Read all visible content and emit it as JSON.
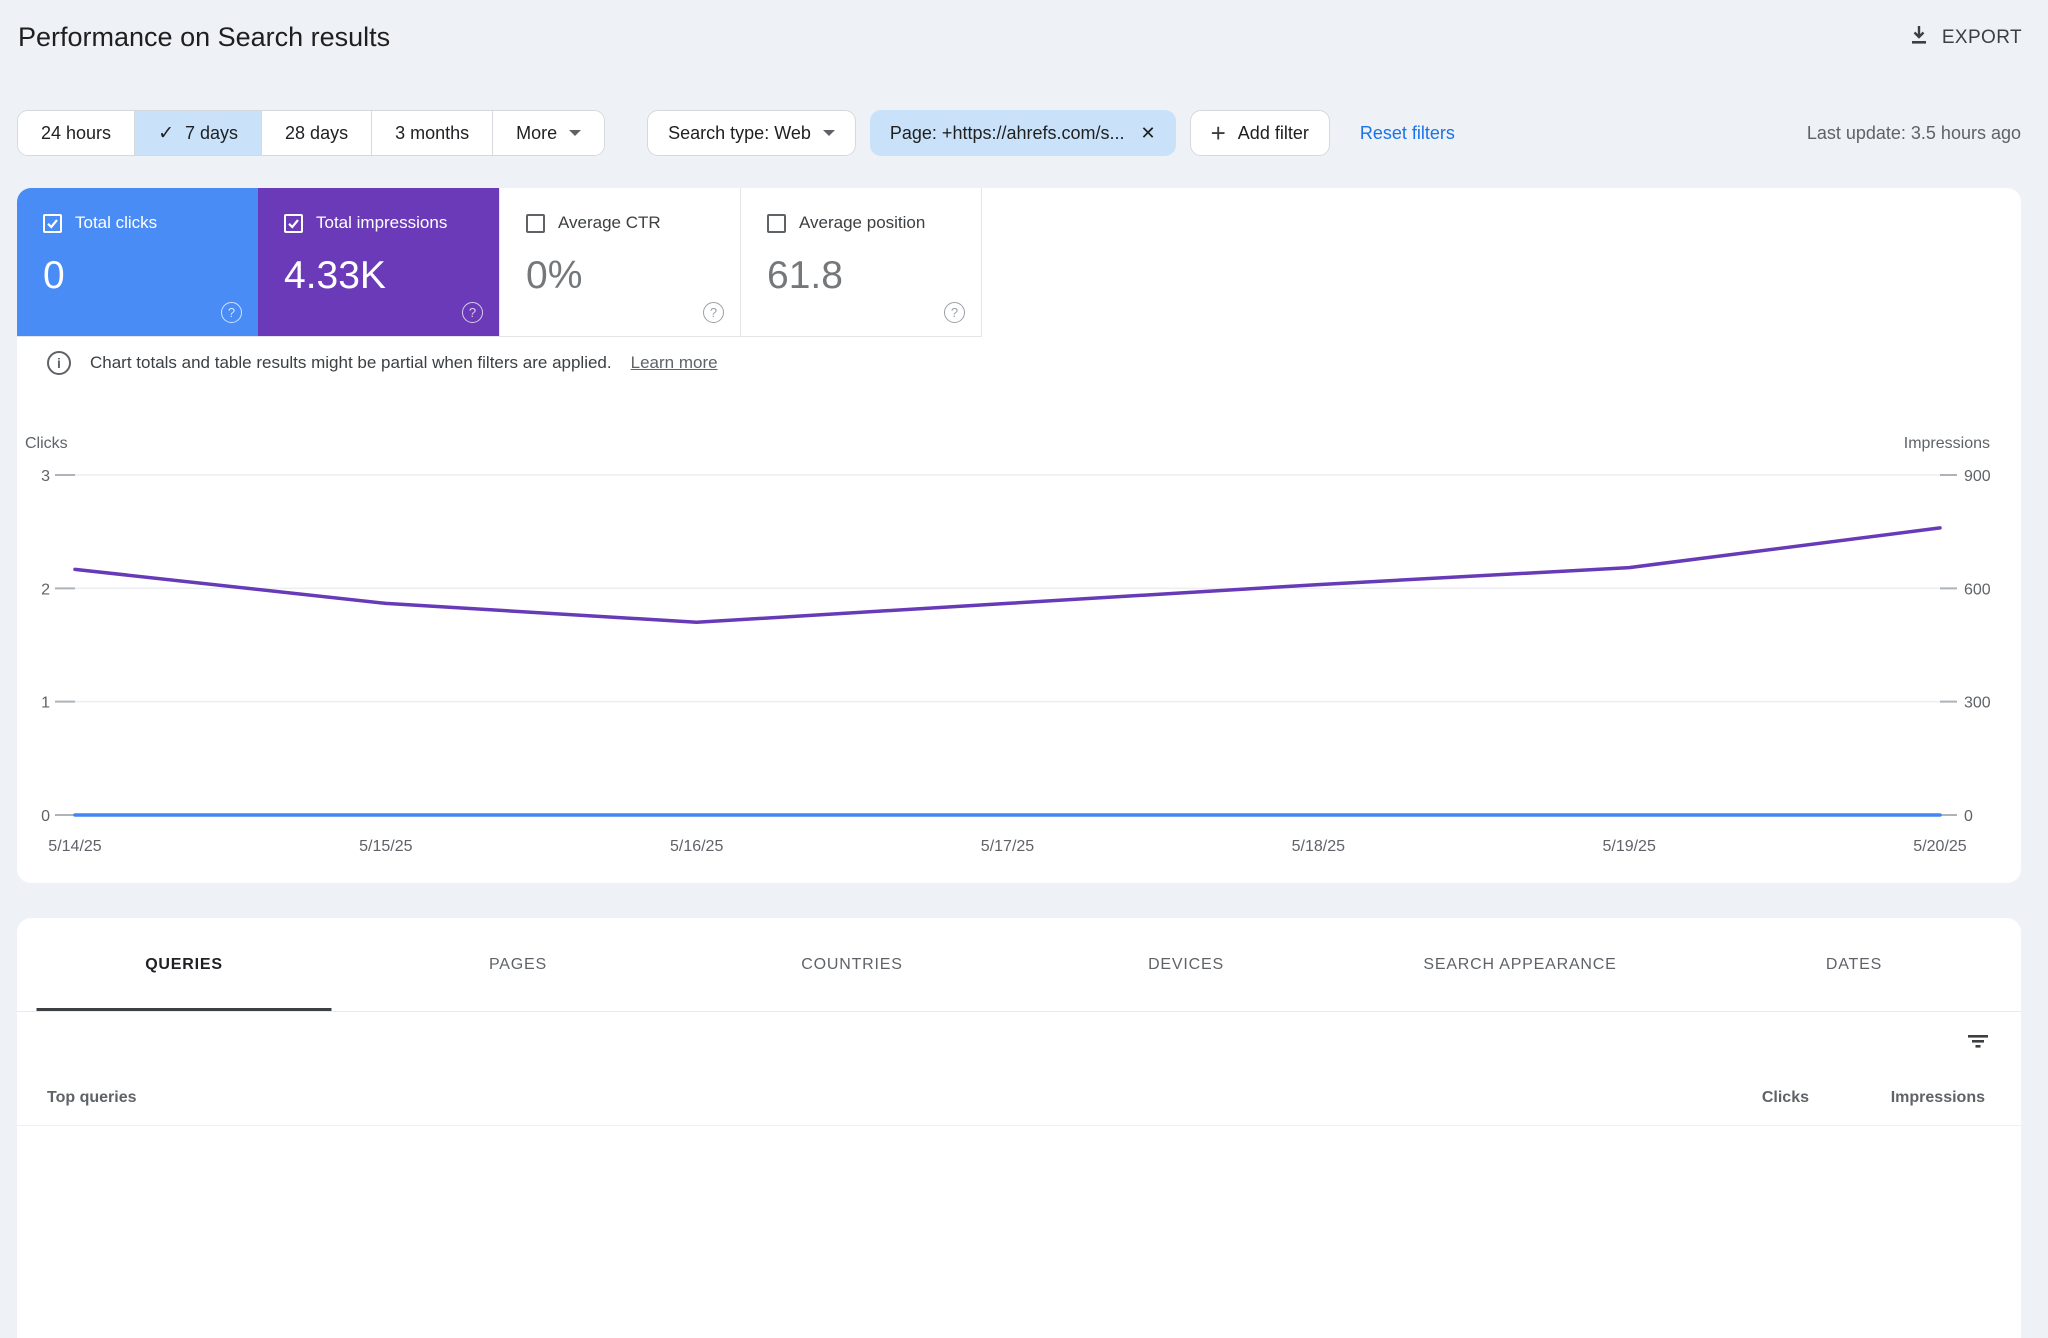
{
  "header": {
    "title": "Performance on Search results",
    "export_label": "EXPORT"
  },
  "toolbar": {
    "ranges": [
      {
        "label": "24 hours",
        "selected": false
      },
      {
        "label": "7 days",
        "selected": true
      },
      {
        "label": "28 days",
        "selected": false
      },
      {
        "label": "3 months",
        "selected": false
      },
      {
        "label": "More",
        "selected": false
      }
    ],
    "search_type_chip": "Search type: Web",
    "page_filter_chip": "Page: +https://ahrefs.com/s...",
    "add_filter_label": "Add filter",
    "reset_label": "Reset filters",
    "last_update": "Last update: 3.5 hours ago"
  },
  "scorecards": [
    {
      "label": "Total clicks",
      "value": "0",
      "checked": true,
      "color": "#4a8cf6"
    },
    {
      "label": "Total impressions",
      "value": "4.33K",
      "checked": true,
      "color": "#6a3ab8"
    },
    {
      "label": "Average CTR",
      "value": "0%",
      "checked": false,
      "color": null
    },
    {
      "label": "Average position",
      "value": "61.8",
      "checked": false,
      "color": null
    }
  ],
  "notice": {
    "text": "Chart totals and table results might be partial when filters are applied.",
    "link": "Learn more"
  },
  "chart_data": {
    "type": "line",
    "x": [
      "5/14/25",
      "5/15/25",
      "5/16/25",
      "5/17/25",
      "5/18/25",
      "5/19/25",
      "5/20/25"
    ],
    "series": [
      {
        "name": "Total clicks",
        "axis": "left",
        "color": "#4285f4",
        "values": [
          0,
          0,
          0,
          0,
          0,
          0,
          0
        ]
      },
      {
        "name": "Total impressions",
        "axis": "right",
        "color": "#673ab7",
        "values": [
          650,
          560,
          510,
          560,
          610,
          655,
          760
        ]
      }
    ],
    "left_axis": {
      "title": "Clicks",
      "ticks": [
        3,
        2,
        1,
        0
      ],
      "max": 3
    },
    "right_axis": {
      "title": "Impressions",
      "ticks": [
        900,
        600,
        300,
        0
      ],
      "max": 900
    },
    "grid": true,
    "legend": "none"
  },
  "table": {
    "tabs": [
      "QUERIES",
      "PAGES",
      "COUNTRIES",
      "DEVICES",
      "SEARCH APPEARANCE",
      "DATES"
    ],
    "active_tab": "QUERIES",
    "columns": [
      "Top queries",
      "Clicks",
      "Impressions"
    ],
    "rows": []
  }
}
